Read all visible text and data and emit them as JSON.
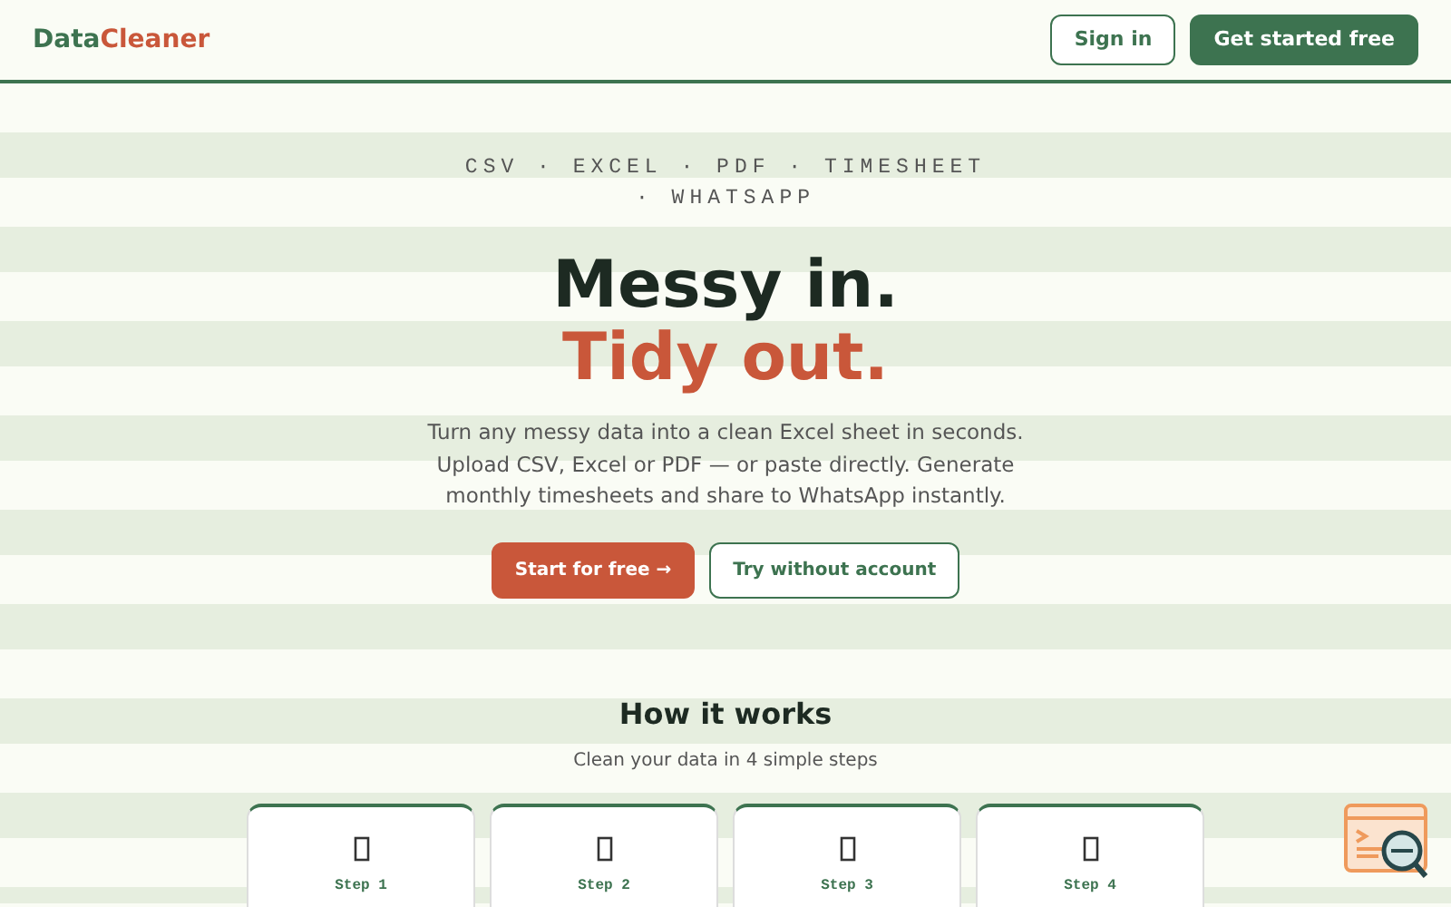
{
  "brand": {
    "part_1": "Data",
    "part_2": "Cleaner"
  },
  "nav_buttons": [
    {
      "label": "Sign in",
      "kind": "outline"
    },
    {
      "label": "Get started free",
      "kind": "solid"
    }
  ],
  "hero": {
    "formats": "CSV · EXCEL · PDF · TIMESHEET · WHATSAPP",
    "title_line_1": "Messy in.",
    "title_line_2": "Tidy out.",
    "description": "Turn any messy data into a clean Excel sheet in seconds. Upload CSV, Excel or PDF — or paste directly. Generate monthly timesheets and share to WhatsApp instantly.",
    "buttons": [
      {
        "label": "Start for free →",
        "kind": "primary"
      },
      {
        "label": "Try without account",
        "kind": "outline"
      }
    ]
  },
  "how_it_works": {
    "title": "How it works",
    "subtitle": "Clean your data in 4 simple steps",
    "steps": [
      {
        "label": "Step 1"
      },
      {
        "label": "Step 2"
      },
      {
        "label": "Step 3"
      },
      {
        "label": "Step 4"
      }
    ]
  }
}
